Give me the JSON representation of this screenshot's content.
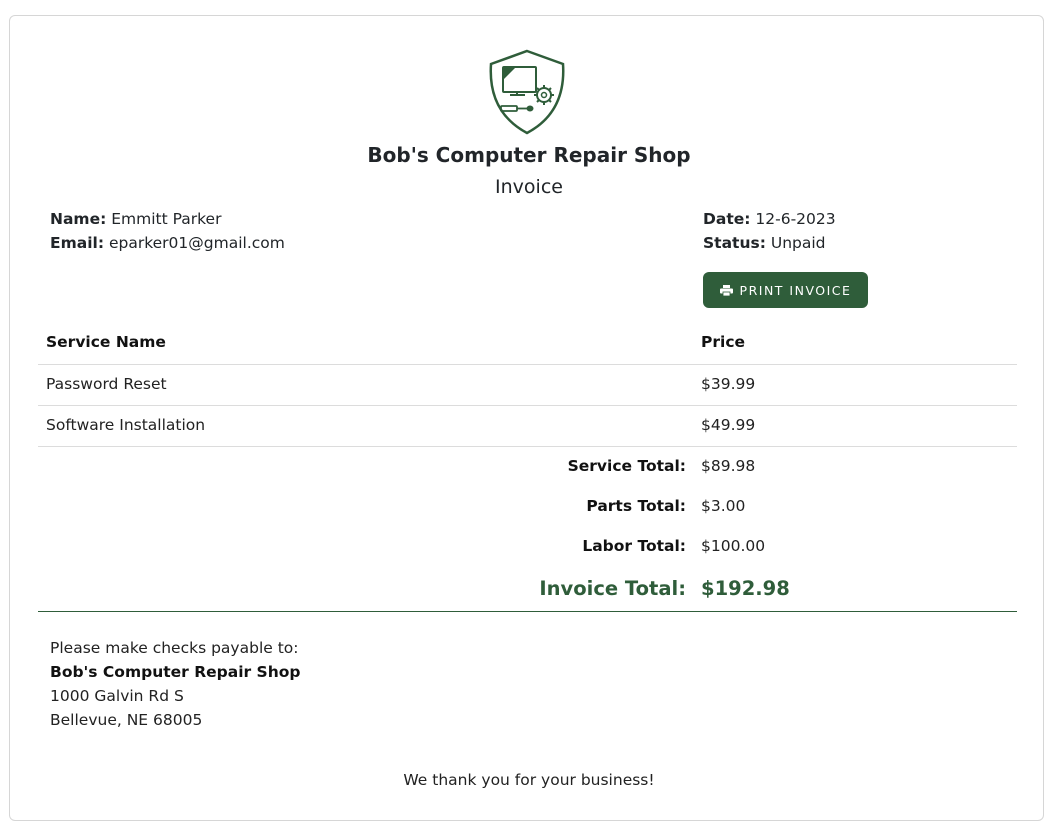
{
  "shop": {
    "name": "Bob's Computer Repair Shop",
    "doc_title": "Invoice",
    "logo_icon": "computer-repair-shield-icon",
    "brand_color": "#2f5d3a"
  },
  "customer": {
    "name_label": "Name:",
    "name": "Emmitt Parker",
    "email_label": "Email:",
    "email": "eparker01@gmail.com"
  },
  "meta": {
    "date_label": "Date:",
    "date": "12-6-2023",
    "status_label": "Status:",
    "status": "Unpaid"
  },
  "actions": {
    "print_label": "PRINT INVOICE",
    "print_icon": "printer-icon"
  },
  "table": {
    "headers": [
      "Service Name",
      "Price"
    ],
    "rows": [
      {
        "service": "Password Reset",
        "price": "$39.99"
      },
      {
        "service": "Software Installation",
        "price": "$49.99"
      }
    ]
  },
  "totals": {
    "service_label": "Service Total:",
    "service": "$89.98",
    "parts_label": "Parts Total:",
    "parts": "$3.00",
    "labor_label": "Labor Total:",
    "labor": "$100.00",
    "invoice_label": "Invoice Total:",
    "invoice": "$192.98"
  },
  "payable": {
    "intro": "Please make checks payable to:",
    "name": "Bob's Computer Repair Shop",
    "address1": "1000 Galvin Rd S",
    "address2": "Bellevue, NE 68005"
  },
  "footer": {
    "thanks": "We thank you for your business!"
  }
}
